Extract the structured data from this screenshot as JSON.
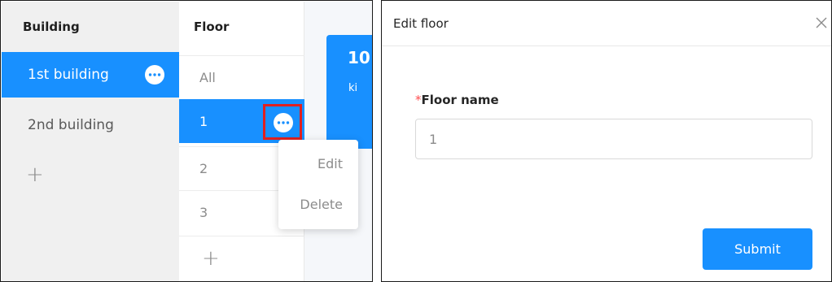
{
  "building_panel": {
    "header": "Building",
    "items": [
      {
        "label": "1st building",
        "active": true
      },
      {
        "label": "2nd building",
        "active": false
      }
    ],
    "add_symbol": "+"
  },
  "floor_panel": {
    "header": "Floor",
    "items": [
      {
        "label": "All"
      },
      {
        "label": "1"
      },
      {
        "label": "2"
      },
      {
        "label": "3"
      }
    ],
    "add_symbol": "+"
  },
  "context_menu": {
    "items": [
      "Edit",
      "Delete"
    ]
  },
  "card": {
    "number": "10",
    "subtitle": "ki"
  },
  "dialog": {
    "title": "Edit floor",
    "field": {
      "required_mark": "*",
      "label": "Floor name",
      "value": "1"
    },
    "submit_label": "Submit"
  },
  "colors": {
    "primary": "#1890ff",
    "highlight": "#e02020",
    "required": "#ff4d4f"
  },
  "icons": [
    "more-dots-icon",
    "close-icon",
    "plus-icon"
  ]
}
